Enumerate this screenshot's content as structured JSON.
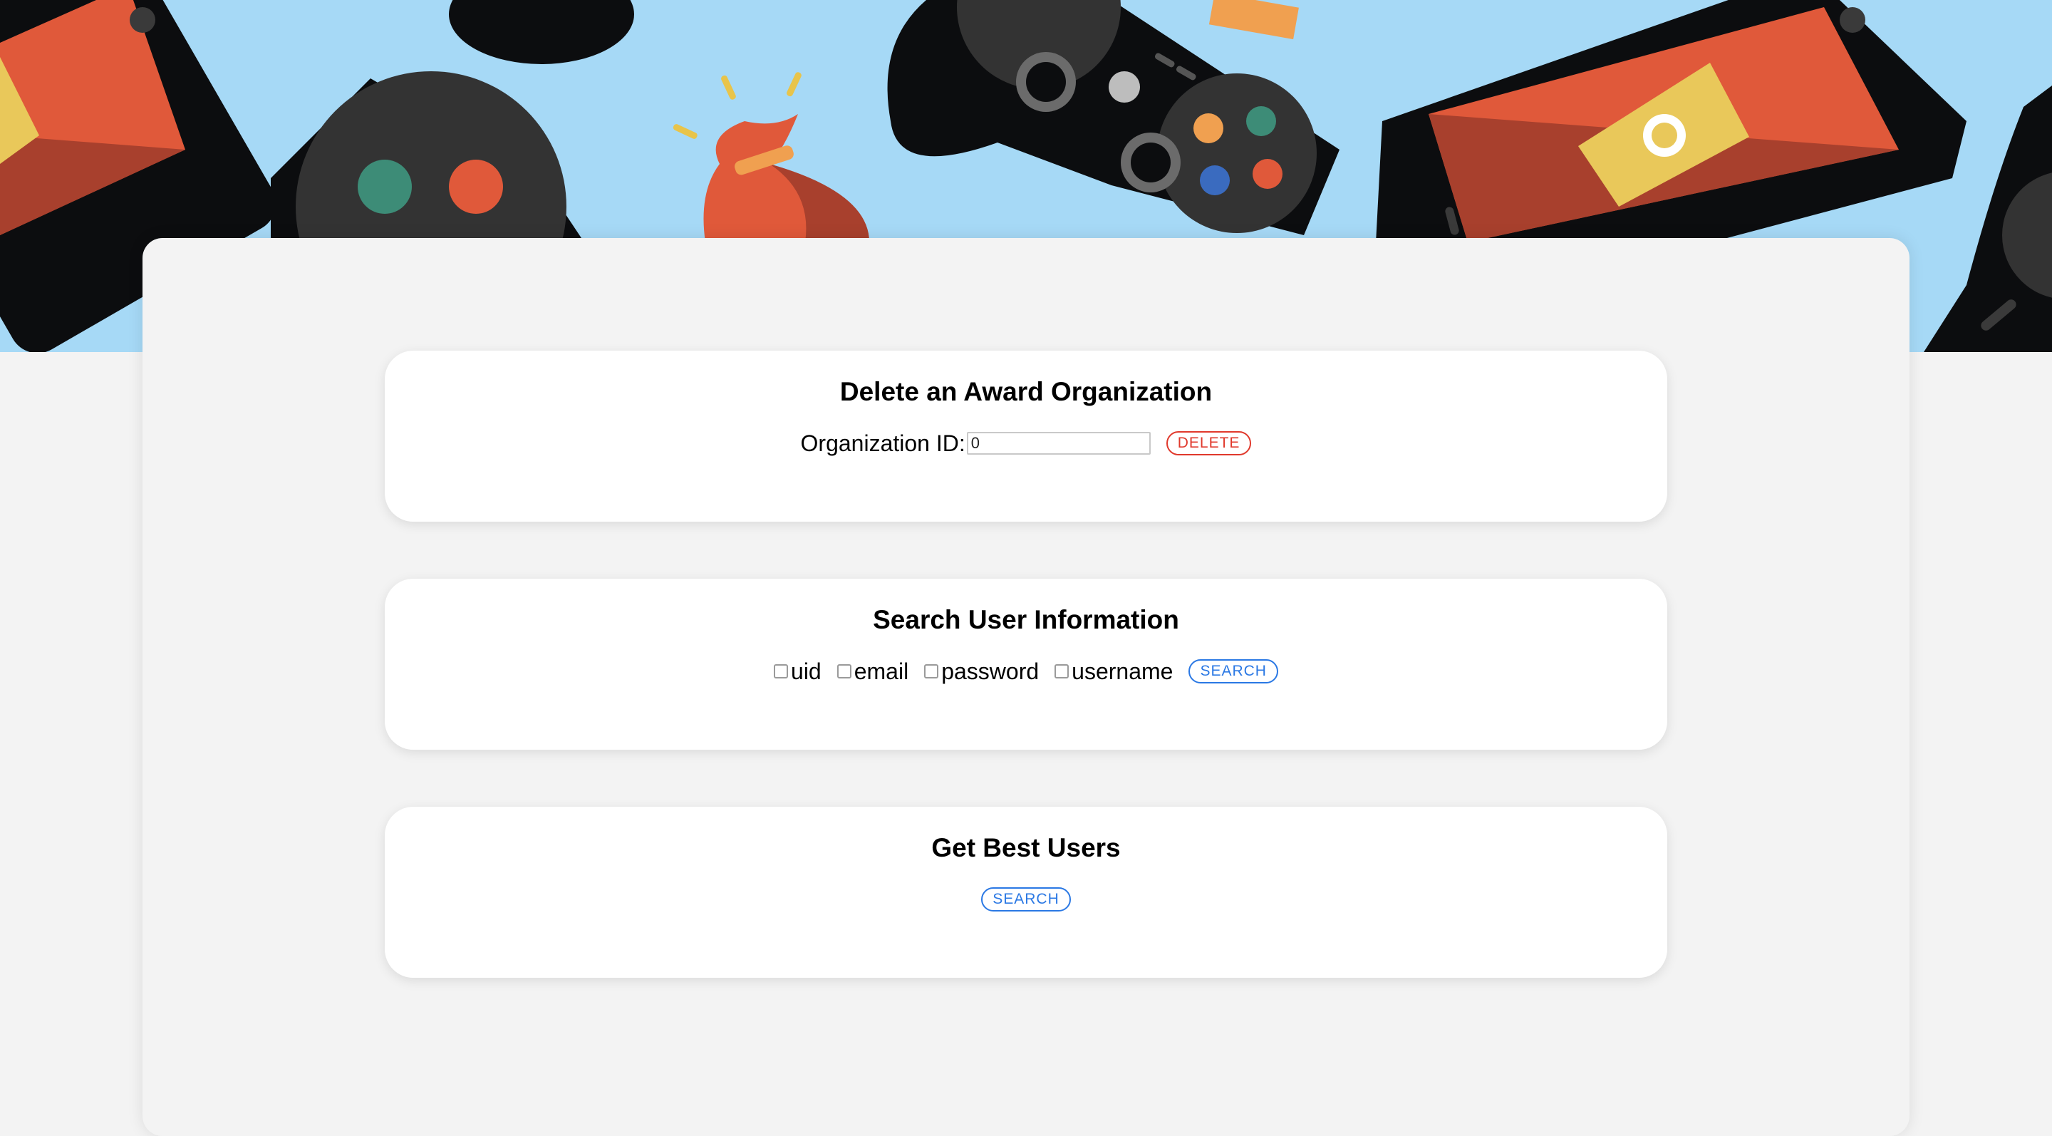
{
  "delete_org": {
    "title": "Delete an Award Organization",
    "field_label": "Organization ID:",
    "field_value": "0",
    "button_label": "DELETE"
  },
  "search_user": {
    "title": "Search User Information",
    "options": [
      "uid",
      "email",
      "password",
      "username"
    ],
    "button_label": "SEARCH"
  },
  "best_users": {
    "title": "Get Best Users",
    "button_label": "SEARCH"
  },
  "colors": {
    "banner_bg": "#a6d9f6",
    "delete_accent": "#e0392c",
    "search_accent": "#2a78e4"
  }
}
